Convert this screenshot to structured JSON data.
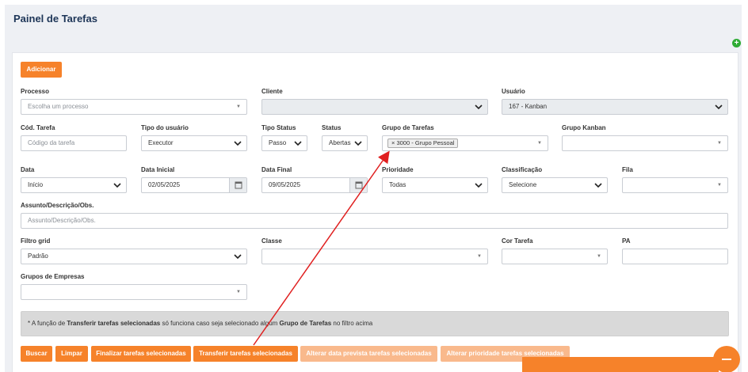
{
  "header": {
    "title": "Painel de Tarefas"
  },
  "actions": {
    "add_label": "Adicionar"
  },
  "filters": {
    "processo": {
      "label": "Processo",
      "placeholder": "Escolha um processo"
    },
    "cliente": {
      "label": "Cliente",
      "value": ""
    },
    "usuario": {
      "label": "Usuário",
      "value": "167 - Kanban"
    },
    "cod_tarefa": {
      "label": "Cód. Tarefa",
      "placeholder": "Código da tarefa"
    },
    "tipo_usuario": {
      "label": "Tipo do usuário",
      "value": "Executor"
    },
    "tipo_status": {
      "label": "Tipo Status",
      "value": "Passo"
    },
    "status": {
      "label": "Status",
      "value": "Abertas"
    },
    "grupo_tarefas": {
      "label": "Grupo de Tarefas",
      "tag": "× 3000 - Grupo Pessoal"
    },
    "grupo_kanban": {
      "label": "Grupo Kanban",
      "value": ""
    },
    "data": {
      "label": "Data",
      "value": "Início"
    },
    "data_inicial": {
      "label": "Data Inicial",
      "value": "02/05/2025"
    },
    "data_final": {
      "label": "Data Final",
      "value": "09/05/2025"
    },
    "prioridade": {
      "label": "Prioridade",
      "value": "Todas"
    },
    "classificacao": {
      "label": "Classificação",
      "value": "Selecione"
    },
    "fila": {
      "label": "Fila",
      "value": ""
    },
    "assunto": {
      "label": "Assunto/Descrição/Obs.",
      "placeholder": "Assunto/Descrição/Obs."
    },
    "filtro_grid": {
      "label": "Filtro grid",
      "value": "Padrão"
    },
    "classe": {
      "label": "Classe",
      "value": ""
    },
    "cor_tarefa": {
      "label": "Cor Tarefa",
      "value": ""
    },
    "pa": {
      "label": "PA",
      "value": ""
    },
    "grupos_empresas": {
      "label": "Grupos de Empresas",
      "value": ""
    }
  },
  "note": {
    "prefix": "* A função de ",
    "bold1": "Transferir tarefas selecionadas",
    "middle": " só funciona caso seja selecionado algum ",
    "bold2": "Grupo de Tarefas",
    "suffix": " no filtro acima"
  },
  "buttons": {
    "buscar": "Buscar",
    "limpar": "Limpar",
    "finalizar": "Finalizar tarefas selecionadas",
    "transferir": "Transferir tarefas selecionadas",
    "alterar_data": "Alterar data prevista tarefas selecionadas",
    "alterar_prioridade": "Alterar prioridade tarefas selecionadas"
  },
  "icons": {
    "plus": "plus-circle-icon",
    "dropdown": "chevron-down-icon",
    "caret": "caret-down-icon",
    "calendar": "calendar-icon",
    "fab": "minus-icon"
  },
  "colors": {
    "accent": "#f6822a",
    "accent_disabled": "#f9b98c",
    "annotation_arrow": "#e02020",
    "add_icon": "#2eab34"
  }
}
